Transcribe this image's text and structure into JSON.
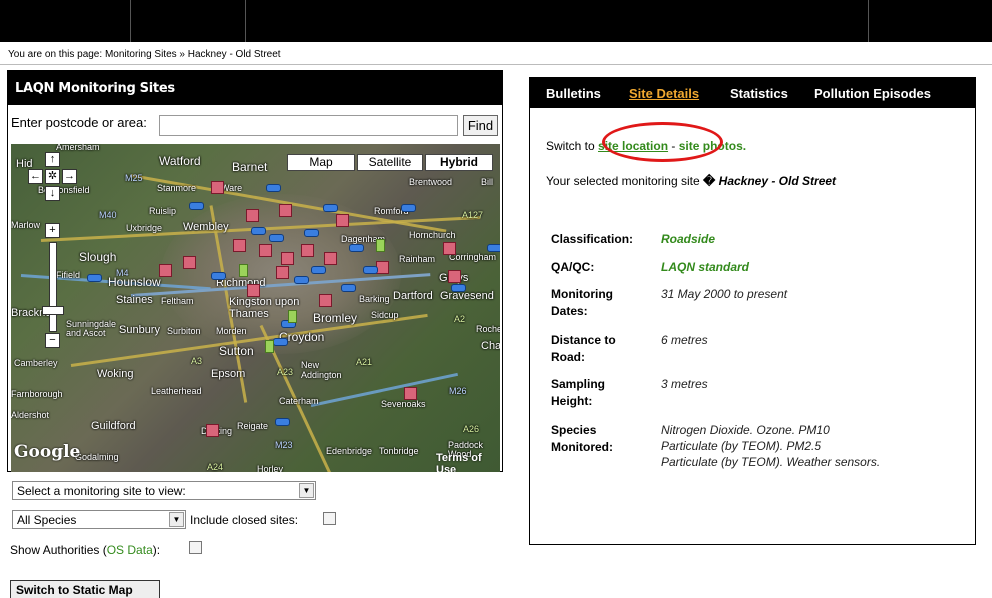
{
  "breadcrumb": {
    "prefix": "You are on this page:",
    "path": "Monitoring Sites » Hackney - Old Street"
  },
  "left_panel": {
    "title": "LAQN Monitoring Sites",
    "postcode_label": "Enter postcode or area:",
    "postcode_value": "",
    "find_label": "Find",
    "map": {
      "types": [
        "Map",
        "Satellite",
        "Hybrid"
      ],
      "selected_type": "Hybrid",
      "controls": {
        "up": "↑",
        "left": "←",
        "center": "✲",
        "right": "→",
        "down": "↓",
        "zoom_in": "+",
        "zoom_out": "−"
      },
      "places": [
        "Amersham",
        "Watford",
        "Barnet",
        "Hid",
        "Beaconsfield",
        "Stanmore",
        "Ware",
        "Brentwood",
        "Bill",
        "Ruislip",
        "Romford",
        "Marlow",
        "Uxbridge",
        "Wembley",
        "Dagenham",
        "Hornchurch",
        "Slough",
        "Rainham",
        "Corringham",
        "Fifield",
        "Hounslow",
        "Richmond",
        "Grays",
        "Staines",
        "Feltham",
        "Kingston upon Thames",
        "Barking",
        "Dartford",
        "Gravesend",
        "Bracknell",
        "Sunningdale and Ascot",
        "Sunbury",
        "Surbiton",
        "Morden",
        "Bromley",
        "Sidcup",
        "Rochester",
        "Chatham",
        "Camberley",
        "Sutton",
        "Croydon",
        "New Addington",
        "Woking",
        "Epsom",
        "Leatherhead",
        "Caterham",
        "Sevenoaks",
        "Farnborough",
        "Aldershot",
        "Guildford",
        "Dorking",
        "Reigate",
        "Godalming",
        "Edenbridge",
        "Tonbridge",
        "Paddock Wood",
        "Horley"
      ],
      "road_labels": [
        "M25",
        "M40",
        "M4",
        "A3",
        "A23",
        "A21",
        "M26",
        "M23",
        "A26",
        "A24",
        "A2",
        "A127"
      ],
      "logo": "Google",
      "terms": "Terms of Use"
    },
    "site_select": "Select a monitoring site to view:",
    "species_select": "All Species",
    "include_closed_label": "Include closed sites:",
    "show_authorities_label": "Show Authorities (",
    "os_data_link": "OS Data",
    "show_authorities_suffix": "):",
    "static_map_button": "Switch to Static Map"
  },
  "right_panel": {
    "tabs": [
      "Bulletins",
      "Site Details",
      "Statistics",
      "Pollution Episodes"
    ],
    "active_tab": "Site Details",
    "switch_prefix": "Switch to",
    "site_location_link": "site location",
    "separator": "-",
    "site_photos_link": "site photos.",
    "selected_prefix": "Your selected monitoring site",
    "selected_marker": "�",
    "selected_site": "Hackney - Old Street",
    "details": [
      {
        "label": "Classification:",
        "value": "Roadside"
      },
      {
        "label": "QA/QC:",
        "value": "LAQN standard"
      },
      {
        "label": "Monitoring Dates:",
        "value": "31 May 2000 to present"
      },
      {
        "label": "Distance to Road:",
        "value": "6 metres"
      },
      {
        "label": "Sampling Height:",
        "value": "3 metres"
      },
      {
        "label": "Species Monitored:",
        "value": "Nitrogen Dioxide. Ozone. PM10 Particulate (by TEOM). PM2.5 Particulate (by TEOM). Weather sensors."
      }
    ],
    "colors": {
      "link_green": "#338a1c",
      "active_tab": "#f0a830",
      "highlight_circle": "#e01818"
    }
  }
}
